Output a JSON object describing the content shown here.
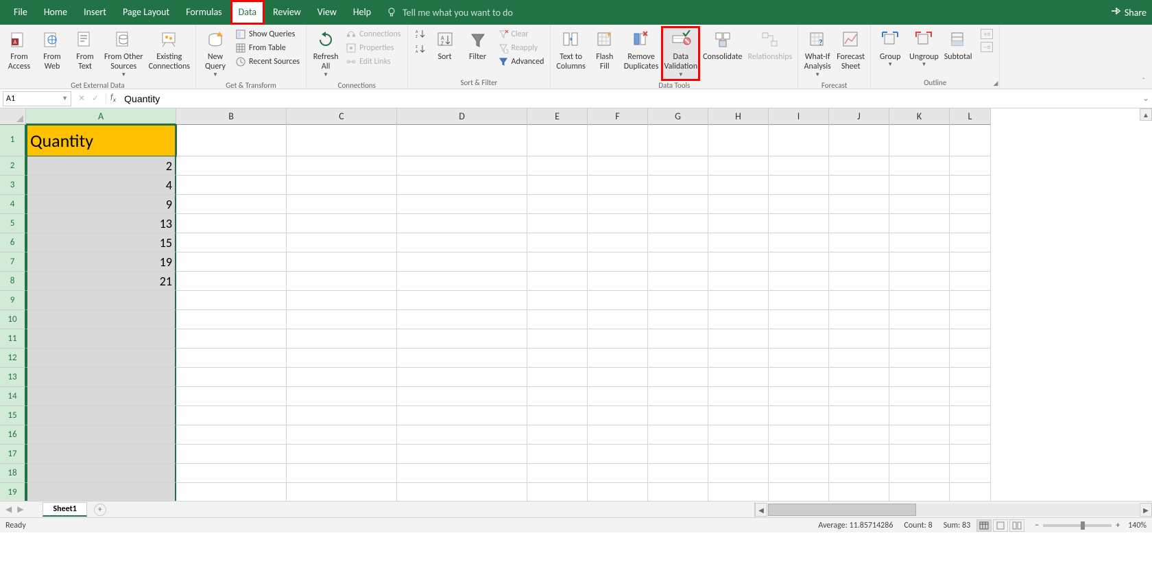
{
  "menu": {
    "tabs": [
      "File",
      "Home",
      "Insert",
      "Page Layout",
      "Formulas",
      "Data",
      "Review",
      "View",
      "Help"
    ],
    "active_tab": "Data",
    "search_placeholder": "Tell me what you want to do",
    "share": "Share"
  },
  "ribbon": {
    "groups": {
      "get_external": {
        "label": "Get External Data",
        "from_access": "From\nAccess",
        "from_web": "From\nWeb",
        "from_text": "From\nText",
        "from_other": "From Other\nSources",
        "existing": "Existing\nConnections"
      },
      "get_transform": {
        "label": "Get & Transform",
        "new_query": "New\nQuery",
        "show_queries": "Show Queries",
        "from_table": "From Table",
        "recent": "Recent Sources"
      },
      "connections": {
        "label": "Connections",
        "refresh": "Refresh\nAll",
        "conns": "Connections",
        "props": "Properties",
        "edit": "Edit Links"
      },
      "sort_filter": {
        "label": "Sort & Filter",
        "sort": "Sort",
        "filter": "Filter",
        "clear": "Clear",
        "reapply": "Reapply",
        "advanced": "Advanced"
      },
      "data_tools": {
        "label": "Data Tools",
        "text_to_cols": "Text to\nColumns",
        "flash_fill": "Flash\nFill",
        "remove_dup": "Remove\nDuplicates",
        "validation": "Data\nValidation",
        "consolidate": "Consolidate",
        "relationships": "Relationships"
      },
      "forecast": {
        "label": "Forecast",
        "whatif": "What-If\nAnalysis",
        "forecast_sheet": "Forecast\nSheet"
      },
      "outline": {
        "label": "Outline",
        "group": "Group",
        "ungroup": "Ungroup",
        "subtotal": "Subtotal"
      }
    }
  },
  "formula_bar": {
    "namebox": "A1",
    "formula": "Quantity"
  },
  "sheet": {
    "columns": [
      "A",
      "B",
      "C",
      "D",
      "E",
      "F",
      "G",
      "H",
      "I",
      "J",
      "K",
      "L"
    ],
    "rows_count": 19,
    "selected_column": "A",
    "active_cell": "A1",
    "data": {
      "A1": "Quantity",
      "A2": "2",
      "A3": "4",
      "A4": "9",
      "A5": "13",
      "A6": "15",
      "A7": "19",
      "A8": "21"
    }
  },
  "tabs": {
    "sheet1": "Sheet1"
  },
  "status": {
    "ready": "Ready",
    "average_label": "Average:",
    "average_value": "11.85714286",
    "count_label": "Count:",
    "count_value": "8",
    "sum_label": "Sum:",
    "sum_value": "83",
    "zoom": "140%"
  }
}
